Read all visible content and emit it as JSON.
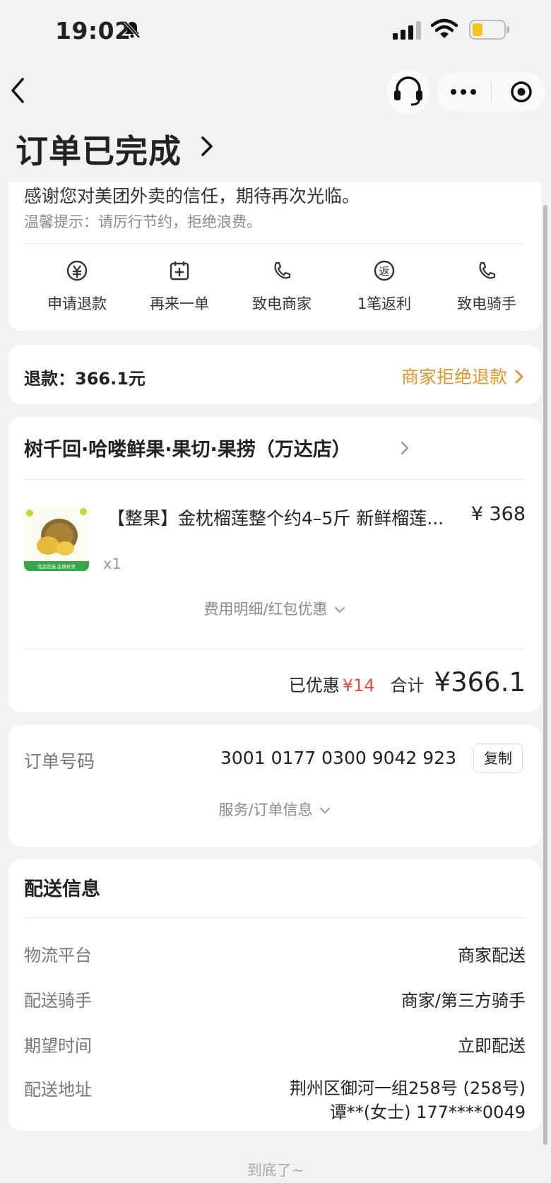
{
  "status_bar": {
    "time": "19:02"
  },
  "header": {
    "title": "订单已完成"
  },
  "notice": {
    "thanks": "感谢您对美团外卖的信任，期待再次光临。",
    "tip": "温馨提示：请厉行节约，拒绝浪费。"
  },
  "actions": [
    {
      "label": "申请退款",
      "icon": "yen-circle-icon"
    },
    {
      "label": "再来一单",
      "icon": "calendar-plus-icon"
    },
    {
      "label": "致电商家",
      "icon": "phone-icon"
    },
    {
      "label": "1笔返利",
      "icon": "rebate-circle-icon"
    },
    {
      "label": "致电骑手",
      "icon": "phone-icon"
    }
  ],
  "refund": {
    "label": "退款：366.1元",
    "status": "商家拒绝退款"
  },
  "shop": {
    "name": "树千回·哈喽鲜果·果切·果捞（万达店）"
  },
  "product": {
    "name": "【整果】金枕榴莲整个约4–5斤 新鲜榴莲...",
    "price": "¥ 368",
    "quantity": "x1",
    "img_caption": "优品优选 品质好货"
  },
  "fee_toggle": "费用明细/红包优惠",
  "summary": {
    "discount_label": "已优惠",
    "discount_amount": "¥14",
    "total_label": "合计",
    "total_amount": "¥366.1"
  },
  "order": {
    "label": "订单号码",
    "number": "3001 0177 0300 9042 923",
    "copy_label": "复制",
    "service_toggle": "服务/订单信息"
  },
  "delivery": {
    "title": "配送信息",
    "rows": [
      {
        "key": "物流平台",
        "value": "商家配送"
      },
      {
        "key": "配送骑手",
        "value": "商家/第三方骑手"
      },
      {
        "key": "期望时间",
        "value": "立即配送"
      },
      {
        "key": "配送地址",
        "value": "荆州区御河一组258号 (258号)",
        "value2": "谭**(女士) 177****0049"
      }
    ]
  },
  "footer": "到底了~",
  "colors": {
    "accent_orange": "#e3962f",
    "discount_red": "#e74c3c",
    "background": "#f2f2f2"
  }
}
